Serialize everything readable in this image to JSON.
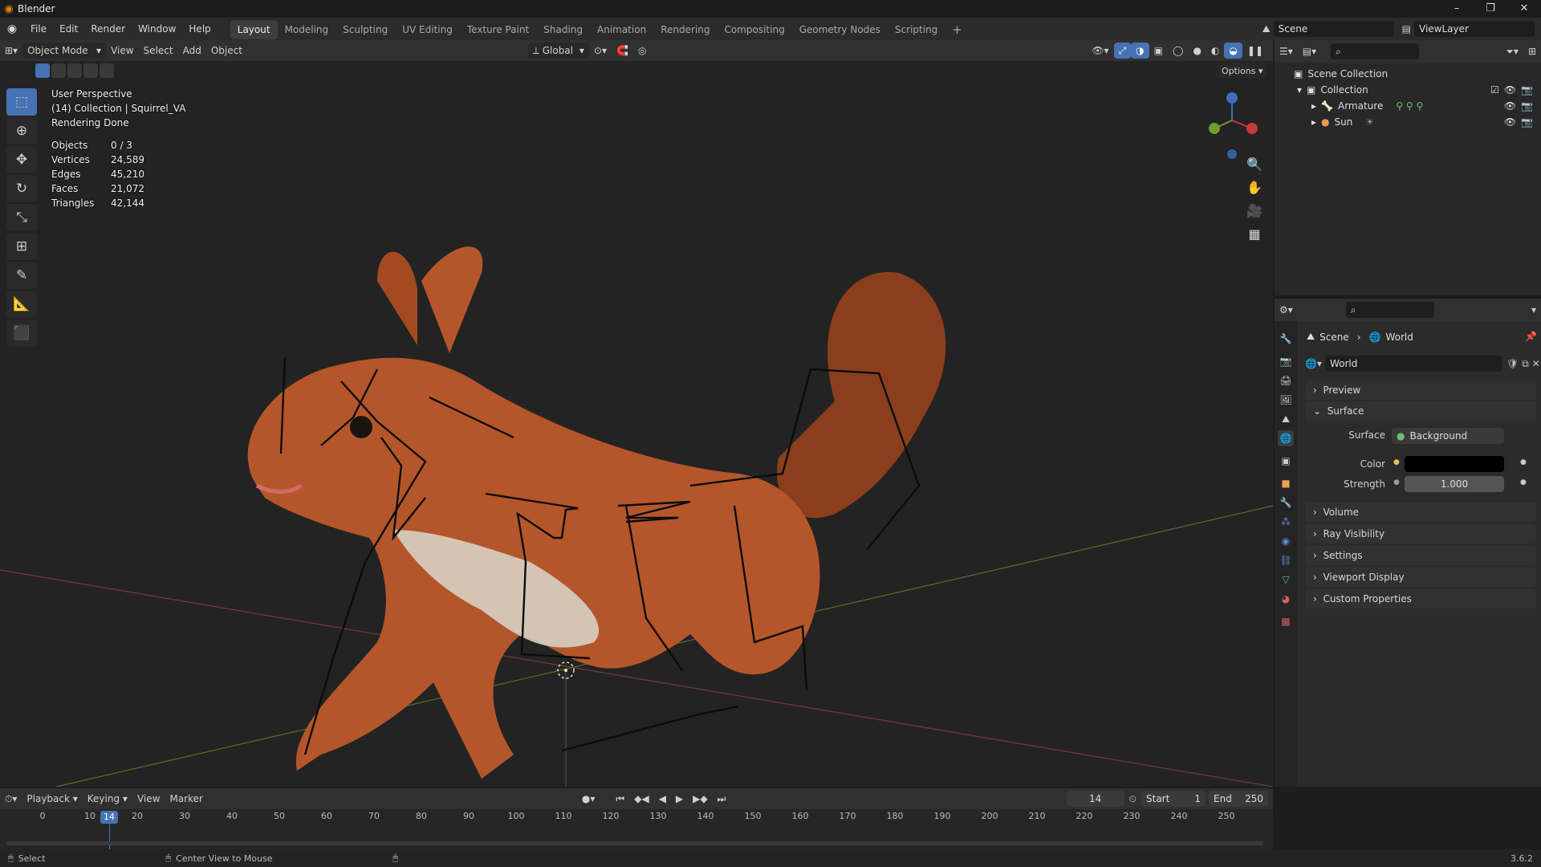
{
  "app": {
    "title": "Blender",
    "version": "3.6.2"
  },
  "menus": [
    "File",
    "Edit",
    "Render",
    "Window",
    "Help"
  ],
  "workspaces": [
    "Layout",
    "Modeling",
    "Sculpting",
    "UV Editing",
    "Texture Paint",
    "Shading",
    "Animation",
    "Rendering",
    "Compositing",
    "Geometry Nodes",
    "Scripting"
  ],
  "active_workspace": "Layout",
  "scene": {
    "name": "Scene",
    "view_layer": "ViewLayer"
  },
  "viewport_header": {
    "mode": "Object Mode",
    "menus": [
      "View",
      "Select",
      "Add",
      "Object"
    ],
    "transform_orientation": "Global",
    "options_label": "Options"
  },
  "viewport_info": {
    "perspective": "User Perspective",
    "collection": "(14) Collection | Squirrel_VA",
    "status": "Rendering Done"
  },
  "stats": [
    {
      "label": "Objects",
      "value": "0 / 3"
    },
    {
      "label": "Vertices",
      "value": "24,589"
    },
    {
      "label": "Edges",
      "value": "45,210"
    },
    {
      "label": "Faces",
      "value": "21,072"
    },
    {
      "label": "Triangles",
      "value": "42,144"
    }
  ],
  "outliner": {
    "root": "Scene Collection",
    "collection": "Collection",
    "items": [
      "Armature",
      "Sun"
    ]
  },
  "properties": {
    "breadcrumb": {
      "scene": "Scene",
      "world": "World"
    },
    "world_name": "World",
    "panels": {
      "preview": "Preview",
      "surface": "Surface",
      "volume": "Volume",
      "ray_visibility": "Ray Visibility",
      "settings": "Settings",
      "viewport_display": "Viewport Display",
      "custom_properties": "Custom Properties"
    },
    "surface_label": "Surface",
    "surface_value": "Background",
    "color_label": "Color",
    "strength_label": "Strength",
    "strength_value": "1.000"
  },
  "timeline": {
    "menus": [
      "Playback",
      "Keying",
      "View",
      "Marker"
    ],
    "current_frame": "14",
    "start_label": "Start",
    "start_value": "1",
    "end_label": "End",
    "end_value": "250",
    "ticks": [
      "0",
      "10",
      "20",
      "30",
      "40",
      "50",
      "60",
      "70",
      "80",
      "90",
      "100",
      "110",
      "120",
      "130",
      "140",
      "150",
      "160",
      "170",
      "180",
      "190",
      "200",
      "210",
      "220",
      "230",
      "240",
      "250"
    ]
  },
  "statusbar": {
    "select": "Select",
    "center": "Center View to Mouse"
  },
  "colors": {
    "accent": "#4772b3",
    "brand": "#e87d0d",
    "squirrel": "#b5562a"
  }
}
